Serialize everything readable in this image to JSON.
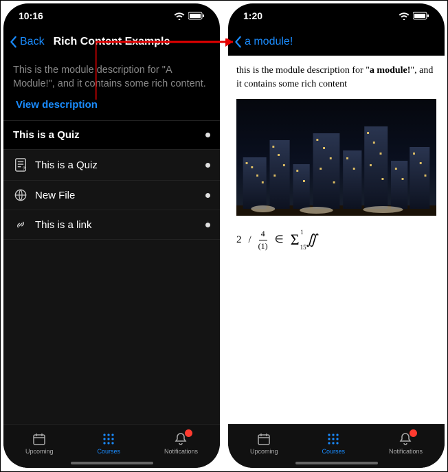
{
  "left": {
    "status_time": "10:16",
    "back_label": "Back",
    "title": "Rich Content Example",
    "description": "This is the module description for \"A Module!\", and it contains some rich content.",
    "view_description": "View description",
    "section_header": "This is a Quiz",
    "rows": [
      {
        "icon": "quiz-icon",
        "label": "This is a Quiz"
      },
      {
        "icon": "globe-icon",
        "label": "New File"
      },
      {
        "icon": "link-icon",
        "label": "This is a link"
      }
    ]
  },
  "right": {
    "status_time": "1:20",
    "back_label": "a module!",
    "body_prefix": "this is the module description for \"",
    "body_bold": "a module!",
    "body_suffix": "\", and it contains some rich content",
    "formula": {
      "t1": "2",
      "slash": "/",
      "frac_top": "4",
      "frac_bot": "(1)",
      "elem": "∈",
      "sigma": "Σ",
      "sup": "1",
      "sub": "15",
      "integral": "∬"
    }
  },
  "tabs": {
    "upcoming": "Upcoming",
    "courses": "Courses",
    "notifications": "Notifications"
  }
}
